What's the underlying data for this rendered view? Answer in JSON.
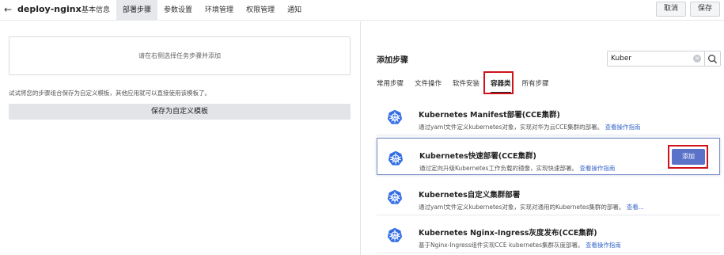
{
  "app": {
    "title": "deploy-nginx"
  },
  "nav_tabs": [
    "基本信息",
    "部署步骤",
    "参数设置",
    "环境管理",
    "权限管理",
    "通知"
  ],
  "active_tab_index": 1,
  "actions": {
    "cancel": "取消",
    "save": "保存"
  },
  "left": {
    "placeholder": "请在右侧选择任务步骤并添加",
    "hint": "试试将您的步骤组合保存为自定义模板，其他应用就可以直接使用该模板了。",
    "save_template": "保存为自定义模板"
  },
  "right": {
    "section_title": "添加步骤",
    "search": {
      "value": "Kuber"
    },
    "categories": [
      "常用步骤",
      "文件操作",
      "软件安装",
      "容器类",
      "所有步骤"
    ],
    "active_category_index": 3,
    "steps": [
      {
        "name": "Kubernetes Manifest部署(CCE集群)",
        "desc": "通过yaml文件定义kubernetes对象，实现对华为云CCE集群的部署。",
        "link": "查看操作指南"
      },
      {
        "name": "Kubernetes快速部署(CCE集群)",
        "desc": "通过定向升级Kubernetes工作负载的镜像，实现快速部署。",
        "link": "查看操作指南",
        "action": "添加"
      },
      {
        "name": "Kubernetes自定义集群部署",
        "desc": "通过yaml文件定义kubernetes对象，实现对通用的Kubernetes集群的部署。",
        "link": "查看..."
      },
      {
        "name": "Kubernetes Nginx-Ingress灰度发布(CCE集群)",
        "desc": "基于Nginx-Ingress组件实现CCE kubernetes集群灰度部署。",
        "link": "查看操作指南"
      }
    ]
  },
  "colors": {
    "accent": "#5a72c8",
    "link": "#3a68c9",
    "highlight_box": "#d0121b",
    "k8s_icon": "#326ce5"
  }
}
